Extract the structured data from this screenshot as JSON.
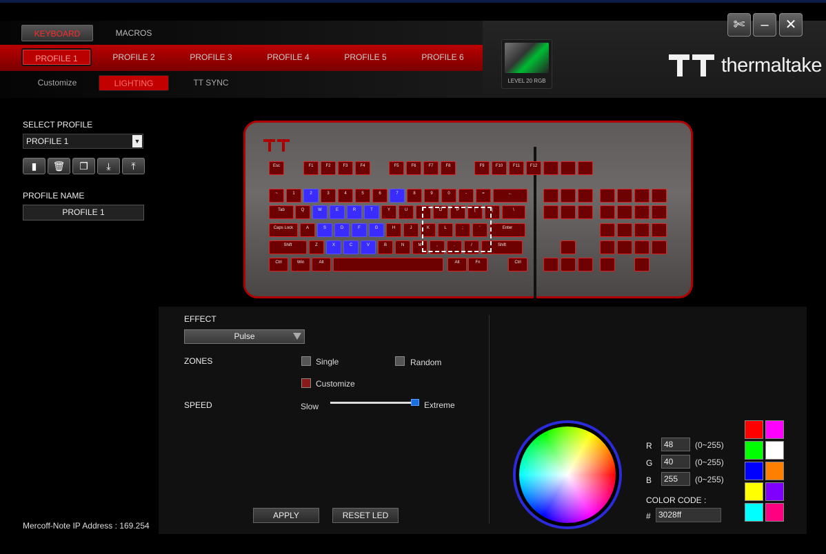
{
  "nav": {
    "keyboard": "KEYBOARD",
    "macros": "MACROS",
    "profiles": [
      "PROFILE 1",
      "PROFILE 2",
      "PROFILE 3",
      "PROFILE 4",
      "PROFILE 5",
      "PROFILE 6"
    ],
    "subtabs": [
      "Customize",
      "LIGHTING",
      "TT SYNC"
    ]
  },
  "device": {
    "label": "LEVEL 20 RGB"
  },
  "brand": {
    "name": "thermaltake"
  },
  "window": {
    "settings_icon": "wrench-icon",
    "minimize_icon": "minimize-icon",
    "close_icon": "close-icon"
  },
  "left": {
    "select_profile_label": "SELECT PROFILE",
    "select_profile_value": "PROFILE 1",
    "profile_icons": [
      "new-profile-icon",
      "delete-icon",
      "copy-icon",
      "import-icon",
      "export-icon"
    ],
    "profile_name_label": "PROFILE NAME",
    "profile_name_value": "PROFILE 1",
    "ip_text": "Mercoff-Note IP Address : 169.254"
  },
  "keyboard": {
    "rows": [
      [
        "Esc",
        "F1",
        "F2",
        "F3",
        "F4",
        "F5",
        "F6",
        "F7",
        "F8",
        "F9",
        "F10",
        "F11",
        "F12"
      ],
      [
        "~",
        "1",
        "2",
        "3",
        "4",
        "5",
        "6",
        "7",
        "8",
        "9",
        "0",
        "-",
        "=",
        "←"
      ],
      [
        "Tab",
        "Q",
        "W",
        "E",
        "R",
        "T",
        "Y",
        "U",
        "I",
        "O",
        "P",
        "[",
        "]",
        "\\"
      ],
      [
        "Caps Lock",
        "A",
        "S",
        "D",
        "F",
        "G",
        "H",
        "J",
        "K",
        "L",
        ";",
        "'",
        "Enter"
      ],
      [
        "Shift",
        "Z",
        "X",
        "C",
        "V",
        "B",
        "N",
        "M",
        ",",
        ".",
        "/",
        "Shift"
      ],
      [
        "Ctrl",
        "Win",
        "Alt",
        "",
        "Alt",
        "Fn",
        "Ctrl"
      ]
    ]
  },
  "lighting": {
    "effect_label": "EFFECT",
    "effect_value": "Pulse",
    "zones_label": "ZONES",
    "zone_single": "Single",
    "zone_random": "Random",
    "zone_customize": "Customize",
    "speed_label": "SPEED",
    "speed_min": "Slow",
    "speed_max": "Extreme",
    "speed_level": 1.0,
    "apply": "APPLY",
    "reset": "RESET LED"
  },
  "color": {
    "r_label": "R",
    "r_value": "48",
    "r_range": "(0~255)",
    "g_label": "G",
    "g_value": "40",
    "g_range": "(0~255)",
    "b_label": "B",
    "b_value": "255",
    "b_range": "(0~255)",
    "code_label": "COLOR CODE :",
    "hash": "#",
    "code_value": "3028ff",
    "swatches": [
      "#ff0000",
      "#ff00ff",
      "#00ff00",
      "#ffffff",
      "#0000ff",
      "#ff8000",
      "#ffff00",
      "#8000ff",
      "#00ffff",
      "#ff0080"
    ]
  }
}
